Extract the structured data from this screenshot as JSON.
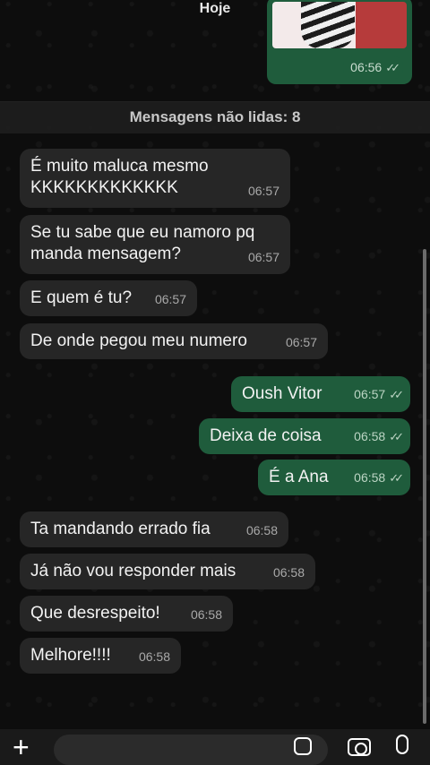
{
  "header": {
    "date_chip": "Hoje"
  },
  "image_message": {
    "time": "06:56"
  },
  "unread_banner": "Mensagens não lidas: 8",
  "messages": [
    {
      "side": "in",
      "text": "É muito maluca mesmo\nKKKKKKKKKKKKK",
      "time": "06:57"
    },
    {
      "side": "in",
      "text": "Se tu sabe que eu namoro pq\nmanda mensagem?",
      "time": "06:57"
    },
    {
      "side": "in",
      "text": "E quem é tu?",
      "time": "06:57"
    },
    {
      "side": "in",
      "text": "De onde pegou meu numero",
      "time": "06:57"
    },
    {
      "side": "out",
      "text": "Oush Vitor",
      "time": "06:57"
    },
    {
      "side": "out",
      "text": "Deixa de coisa",
      "time": "06:58"
    },
    {
      "side": "out",
      "text": "É a Ana",
      "time": "06:58"
    },
    {
      "side": "in",
      "text": "Ta mandando errado fia",
      "time": "06:58"
    },
    {
      "side": "in",
      "text": "Já não vou responder mais",
      "time": "06:58"
    },
    {
      "side": "in",
      "text": "Que desrespeito!",
      "time": "06:58"
    },
    {
      "side": "in",
      "text": "Melhore!!!!",
      "time": "06:58"
    }
  ],
  "composer": {
    "plus_icon": "plus-icon",
    "sticker_icon": "sticker-icon",
    "camera_icon": "camera-icon",
    "mic_icon": "microphone-icon"
  }
}
